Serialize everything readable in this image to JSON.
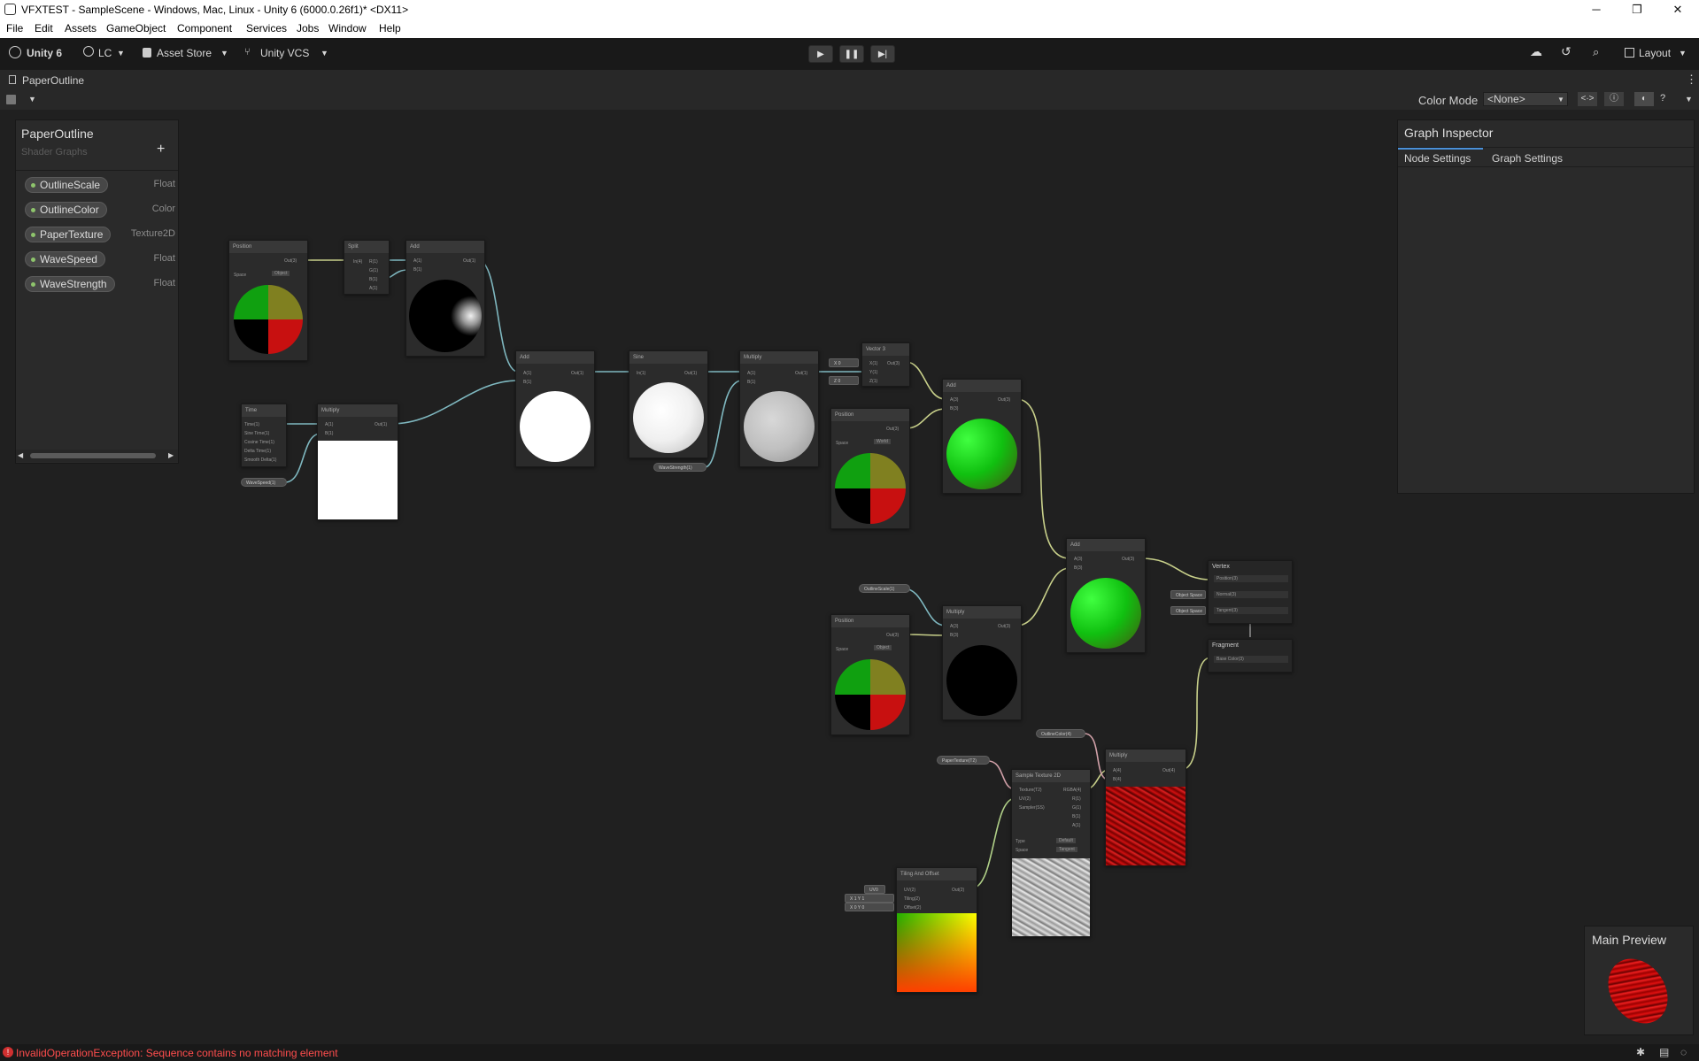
{
  "window": {
    "title": "VFXTEST - SampleScene - Windows, Mac, Linux - Unity 6 (6000.0.26f1)* <DX11>",
    "minimize": "─",
    "maximize": "❐",
    "close": "✕"
  },
  "menu": [
    "File",
    "Edit",
    "Assets",
    "GameObject",
    "Component",
    "Services",
    "Jobs",
    "Window",
    "Help"
  ],
  "toolbar": {
    "unity": "Unity 6",
    "account": "LC",
    "asset_store": "Asset Store",
    "vcs": "Unity VCS",
    "layout": "Layout",
    "play": "▶",
    "pause": "❚❚",
    "step": "▶|"
  },
  "tab": {
    "label": "PaperOutline"
  },
  "graph_toolbar": {
    "color_mode_label": "Color Mode",
    "color_mode_value": "<None>"
  },
  "blackboard": {
    "title": "PaperOutline",
    "subtitle": "Shader Graphs",
    "add": "+",
    "properties": [
      {
        "name": "OutlineScale",
        "type": "Float"
      },
      {
        "name": "OutlineColor",
        "type": "Color"
      },
      {
        "name": "PaperTexture",
        "type": "Texture2D"
      },
      {
        "name": "WaveSpeed",
        "type": "Float"
      },
      {
        "name": "WaveStrength",
        "type": "Float"
      }
    ]
  },
  "inspector": {
    "title": "Graph Inspector",
    "tabs": [
      "Node Settings",
      "Graph Settings"
    ]
  },
  "nodes": {
    "position1": {
      "title": "Position",
      "out": "Out(3)",
      "space_label": "Space",
      "space_value": "Object"
    },
    "split": {
      "title": "Split",
      "in": "In(4)",
      "outs": [
        "R(1)",
        "G(1)",
        "B(1)",
        "A(1)"
      ]
    },
    "add1": {
      "title": "Add",
      "a": "A(1)",
      "b": "B(1)",
      "out": "Out(1)"
    },
    "time": {
      "title": "Time",
      "outs": [
        "Time(1)",
        "Sine Time(1)",
        "Cosine Time(1)",
        "Delta Time(1)",
        "Smooth Delta(1)"
      ]
    },
    "multiply1": {
      "title": "Multiply",
      "a": "A(1)",
      "b": "B(1)",
      "out": "Out(1)"
    },
    "wavespeed_chip": "WaveSpeed(1)",
    "add2": {
      "title": "Add",
      "a": "A(1)",
      "b": "B(1)",
      "out": "Out(1)"
    },
    "sine": {
      "title": "Sine",
      "in": "In(1)",
      "out": "Out(1)"
    },
    "wavestrength_chip": "WaveStrength(1)",
    "multiply2": {
      "title": "Multiply",
      "a": "A(1)",
      "b": "B(1)",
      "out": "Out(1)"
    },
    "vector3": {
      "title": "Vector 3",
      "x": "X(1)",
      "y": "Y(1)",
      "z": "Z(1)",
      "out": "Out(3)",
      "xv": "X  0",
      "zv": "Z  0"
    },
    "position2": {
      "title": "Position",
      "out": "Out(3)",
      "space_label": "Space",
      "space_value": "World"
    },
    "add3": {
      "title": "Add",
      "a": "A(3)",
      "b": "B(3)",
      "out": "Out(3)"
    },
    "outlinescale_chip": "OutlineScale(1)",
    "position3": {
      "title": "Position",
      "out": "Out(3)",
      "space_label": "Space",
      "space_value": "Object"
    },
    "multiply3": {
      "title": "Multiply",
      "a": "A(3)",
      "b": "B(3)",
      "out": "Out(3)"
    },
    "add4": {
      "title": "Add",
      "a": "A(3)",
      "b": "B(3)",
      "out": "Out(3)"
    },
    "vertex": {
      "title": "Vertex",
      "ports": [
        "Position(3)",
        "Normal(3)",
        "Tangent(3)"
      ],
      "chips": [
        "Object Space",
        "Object Space"
      ]
    },
    "fragment": {
      "title": "Fragment",
      "ports": [
        "Base Color(3)"
      ]
    },
    "outlinecolor_chip": "OutlineColor(4)",
    "papertexture_chip": "PaperTexture(T2)",
    "sample": {
      "title": "Sample Texture 2D",
      "ins": [
        "Texture(T2)",
        "UV(2)",
        "Sampler(SS)"
      ],
      "outs": [
        "RGBA(4)",
        "R(1)",
        "G(1)",
        "B(1)",
        "A(1)"
      ],
      "type_label": "Type",
      "type_value": "Default",
      "space_label": "Space",
      "space_value": "Tangent"
    },
    "multiply4": {
      "title": "Multiply",
      "a": "A(4)",
      "b": "B(4)",
      "out": "Out(4)"
    },
    "tiling": {
      "title": "Tiling And Offset",
      "ins": [
        "UV(2)",
        "Tiling(2)",
        "Offset(2)"
      ],
      "out": "Out(2)",
      "uv_value": "UV0",
      "tiling_vals": "X 1   Y 1",
      "offset_vals": "X 0   Y 0"
    }
  },
  "preview": {
    "title": "Main Preview"
  },
  "status": {
    "message": "InvalidOperationException: Sequence contains no matching element"
  }
}
